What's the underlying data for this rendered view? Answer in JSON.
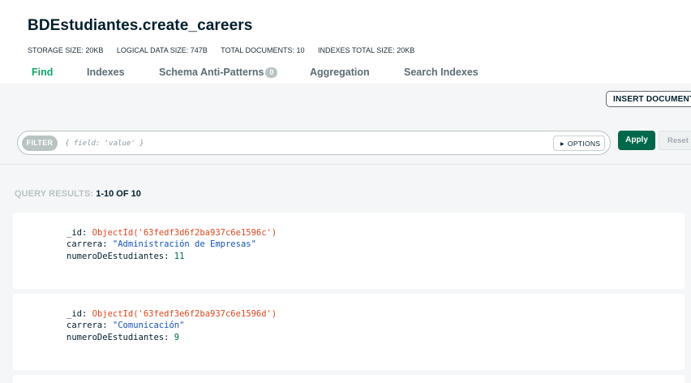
{
  "header": {
    "title": "BDEstudiantes.create_careers",
    "stats": {
      "storage_size": "STORAGE SIZE: 20KB",
      "logical_data_size": "LOGICAL DATA SIZE: 747B",
      "total_documents": "TOTAL DOCUMENTS: 10",
      "indexes_total_size": "INDEXES TOTAL SIZE: 20KB"
    }
  },
  "tabs": [
    {
      "label": "Find",
      "active": true
    },
    {
      "label": "Indexes",
      "active": false
    },
    {
      "label": "Schema Anti-Patterns",
      "badge": "0",
      "active": false
    },
    {
      "label": "Aggregation",
      "active": false
    },
    {
      "label": "Search Indexes",
      "active": false
    }
  ],
  "toolbar": {
    "insert_label": "INSERT DOCUMENT"
  },
  "filter": {
    "badge": "FILTER",
    "placeholder": "{ field: 'value' }",
    "value": "",
    "options_label": "OPTIONS",
    "apply_label": "Apply",
    "reset_label": "Reset"
  },
  "results": {
    "label": "QUERY RESULTS:",
    "count": "1-10 OF 10"
  },
  "documents": [
    {
      "id_key": "_id:",
      "id_value": "ObjectId('63fedf3d6f2ba937c6e1596c')",
      "carrera_key": "carrera:",
      "carrera_value": "\"Administración de Empresas\"",
      "num_key": "numeroDeEstudiantes:",
      "num_value": "11"
    },
    {
      "id_key": "_id:",
      "id_value": "ObjectId('63fedf3e6f2ba937c6e1596d')",
      "carrera_key": "carrera:",
      "carrera_value": "\"Comunicación\"",
      "num_key": "numeroDeEstudiantes:",
      "num_value": "9"
    }
  ],
  "colors": {
    "accent_green": "#13a46a",
    "apply_green": "#00684a",
    "objectid_red": "#e0471f",
    "string_blue": "#1254b7",
    "number_green": "#00684a"
  }
}
